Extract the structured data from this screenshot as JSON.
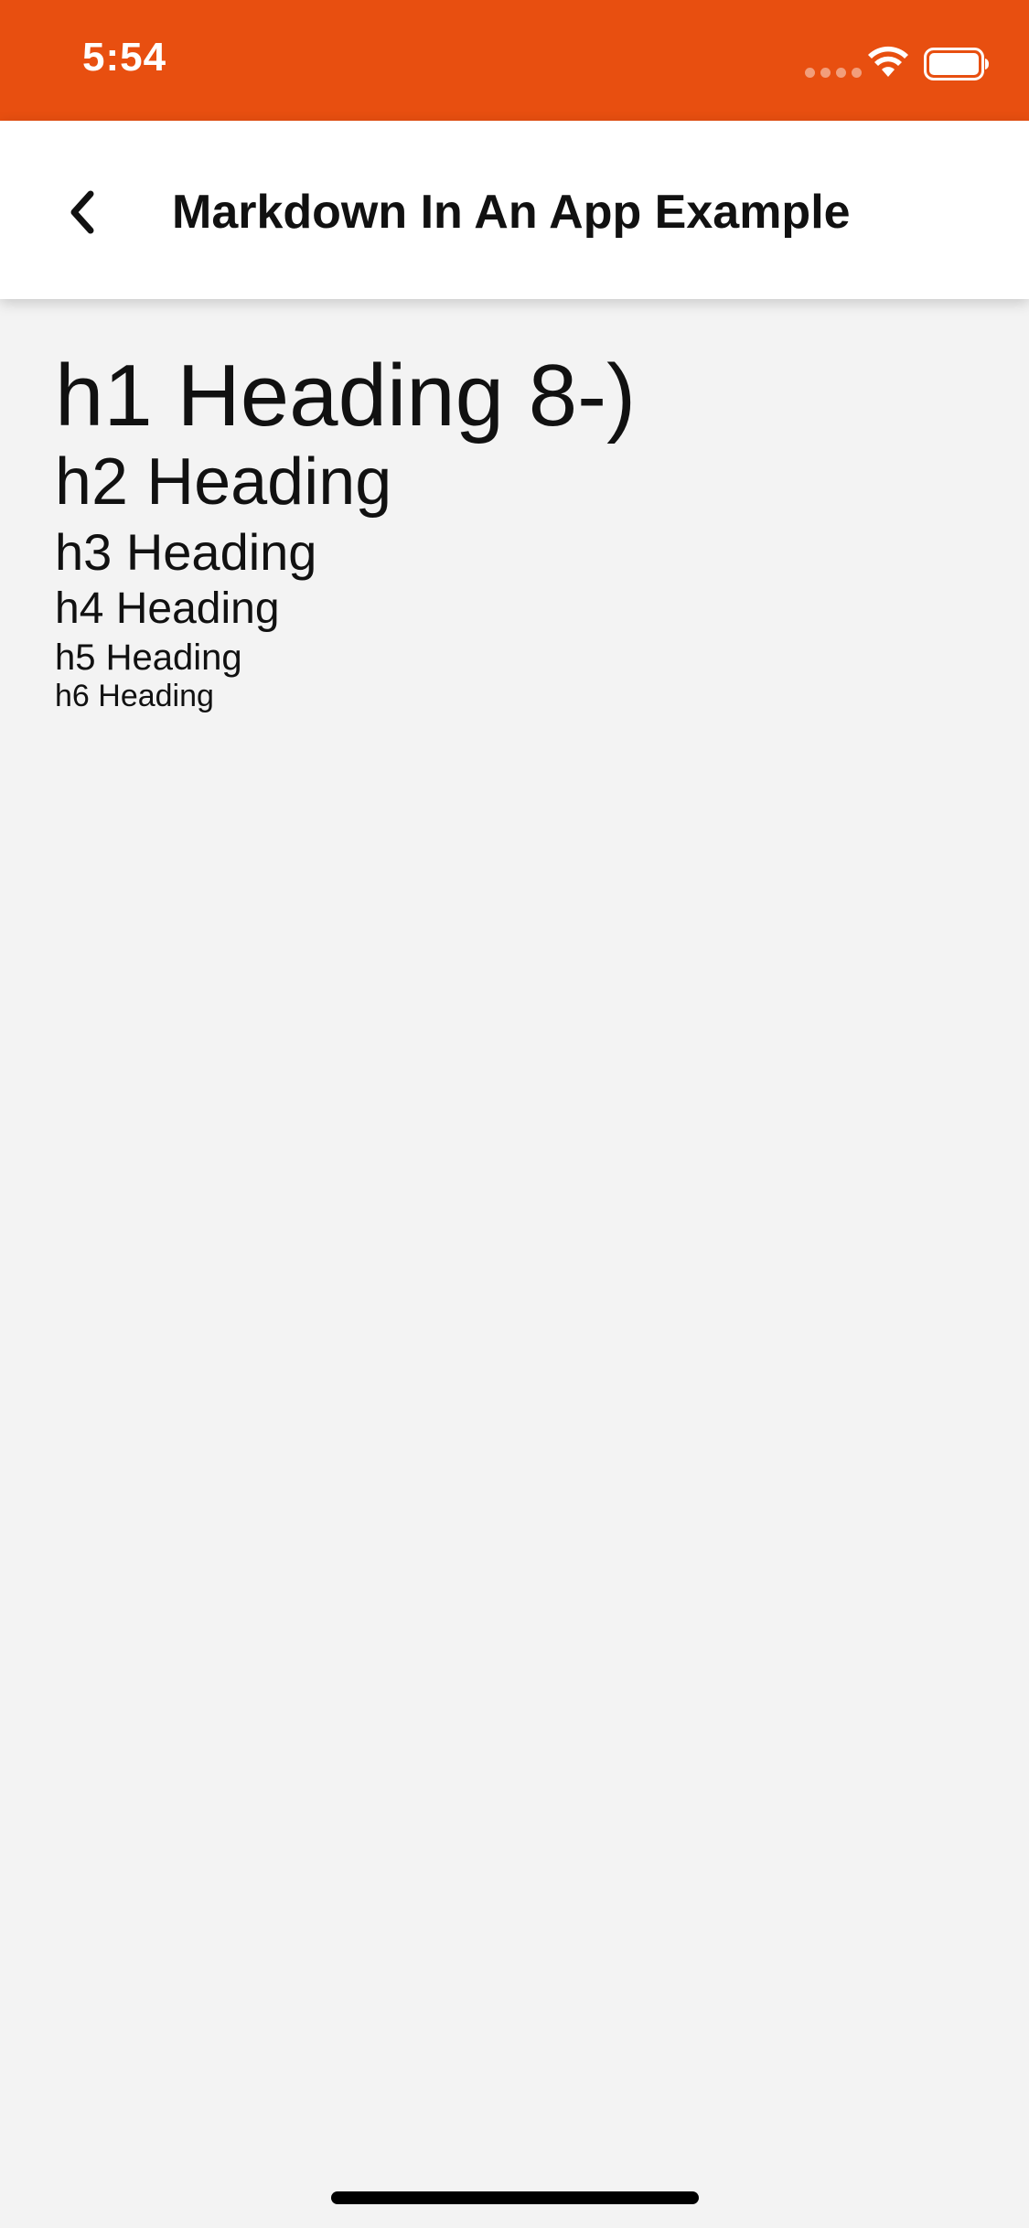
{
  "status_bar": {
    "time": "5:54",
    "background_color": "#e84f10",
    "icons": [
      "signal-dots-icon",
      "wifi-icon",
      "battery-icon"
    ]
  },
  "nav": {
    "title": "Markdown In An App Example",
    "back_icon": "chevron-left-icon"
  },
  "content": {
    "headings": [
      {
        "level": "h1",
        "text": "h1 Heading 8-)"
      },
      {
        "level": "h2",
        "text": "h2 Heading"
      },
      {
        "level": "h3",
        "text": "h3 Heading"
      },
      {
        "level": "h4",
        "text": "h4 Heading"
      },
      {
        "level": "h5",
        "text": "h5 Heading"
      },
      {
        "level": "h6",
        "text": "h6 Heading"
      }
    ]
  },
  "colors": {
    "accent": "#e84f10",
    "background": "#f3f3f3",
    "nav_background": "#ffffff",
    "text": "#111111"
  }
}
